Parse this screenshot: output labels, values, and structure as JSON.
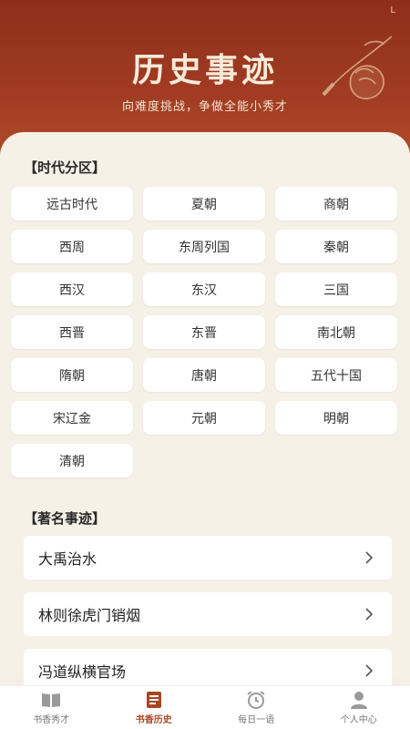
{
  "status_corner": "L",
  "header": {
    "title": "历史事迹",
    "subtitle": "向难度挑战，争做全能小秀才"
  },
  "eras": {
    "title": "【时代分区】",
    "items": [
      "远古时代",
      "夏朝",
      "商朝",
      "西周",
      "东周列国",
      "秦朝",
      "西汉",
      "东汉",
      "三国",
      "西晋",
      "东晋",
      "南北朝",
      "隋朝",
      "唐朝",
      "五代十国",
      "宋辽金",
      "元朝",
      "明朝",
      "清朝"
    ]
  },
  "events": {
    "title": "【著名事迹】",
    "items": [
      "大禹治水",
      "林则徐虎门销烟",
      "冯道纵横官场"
    ]
  },
  "nav": {
    "items": [
      {
        "label": "书香秀才",
        "icon": "book-icon"
      },
      {
        "label": "书香历史",
        "icon": "history-book-icon"
      },
      {
        "label": "每日一语",
        "icon": "alarm-clock-icon"
      },
      {
        "label": "个人中心",
        "icon": "user-icon"
      }
    ],
    "active_color": "#a64622"
  },
  "colors": {
    "header_red": "#a23d22",
    "background": "#f6f1e7"
  }
}
